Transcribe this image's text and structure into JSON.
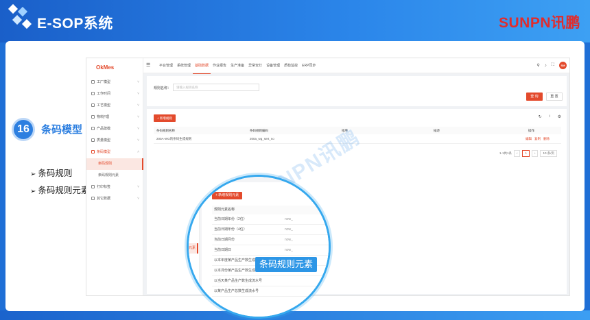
{
  "header": {
    "title": "E-SOP系统",
    "brand": "SUNPN讯鹏"
  },
  "step": {
    "number": "16",
    "title": "条码模型",
    "bullets": [
      "条码规则",
      "条码规则元素"
    ]
  },
  "app": {
    "logo": "OkMes",
    "menu": [
      {
        "label": "工厂模型",
        "type": "group"
      },
      {
        "label": "工作时间",
        "type": "group"
      },
      {
        "label": "工艺模型",
        "type": "group"
      },
      {
        "label": "物料Ƒ理",
        "type": "group"
      },
      {
        "label": "产品建模",
        "type": "group"
      },
      {
        "label": "质量模型",
        "type": "group"
      },
      {
        "label": "条码模型",
        "type": "open"
      },
      {
        "label": "条码规则",
        "type": "active"
      },
      {
        "label": "条码规则元素",
        "type": "sub"
      },
      {
        "label": "打印标签",
        "type": "group"
      },
      {
        "label": "其它数据",
        "type": "group"
      }
    ],
    "nav_tabs": [
      "平台管理",
      "系统管理",
      "基础数据",
      "作业报告",
      "生产准备",
      "异常安灯",
      "设备管理",
      "质检监控",
      "ERP同步"
    ],
    "nav_selected": 2,
    "avatar": "SM",
    "filter": {
      "label": "规则名称：",
      "placeholder": "请输入规则名称",
      "query_btn": "查 询",
      "reset_btn": "重 置"
    },
    "table": {
      "add_btn": "+ 新增规则",
      "columns": [
        "条码规则名称",
        "条码规则编码",
        "排序",
        "描述",
        "操作"
      ],
      "rows": [
        {
          "name": "200A-WG的条码生成规则",
          "code": "200a_wg_sert_no",
          "order": "",
          "desc": "",
          "actions": [
            "编辑",
            "复制",
            "删除"
          ]
        }
      ],
      "pager": {
        "total": "1-1共1条",
        "page": "1",
        "size": "10 条/页"
      }
    }
  },
  "zoom": {
    "sidebar_label": "元素",
    "add_btn": "+ 新增规则元素",
    "header": "规则元素名称",
    "rows": [
      {
        "name": "当前日期年份（2位）",
        "right": "now_"
      },
      {
        "name": "当前日期年份（4位）",
        "right": "now_"
      },
      {
        "name": "当前日期月份",
        "right": "now_"
      },
      {
        "name": "当前日期日",
        "right": "now_"
      },
      {
        "name": "以本年度某产品生产数生成流水号",
        "right": ""
      },
      {
        "name": "以本月份某产品生产数生成流水号",
        "right": ""
      },
      {
        "name": "以当天某产品生产数生成流水号",
        "right": ""
      },
      {
        "name": "以某产品生产总数生成流水号",
        "right": ""
      }
    ]
  },
  "badge": "条码规则元素",
  "watermark": "SUNPN讯鹏"
}
